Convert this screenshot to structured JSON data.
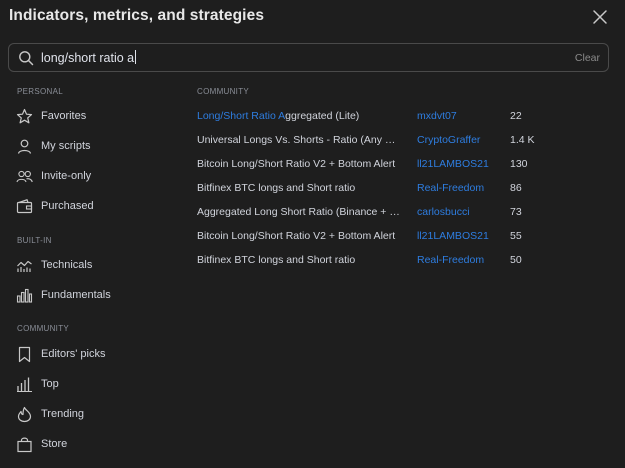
{
  "dialog": {
    "title": "Indicators, metrics, and strategies"
  },
  "search": {
    "value": "long/short ratio a",
    "clear_label": "Clear"
  },
  "sidebar": {
    "personal_heading": "PERSONAL",
    "personal": [
      {
        "label": "Favorites",
        "icon": "star-icon"
      },
      {
        "label": "My scripts",
        "icon": "user-icon"
      },
      {
        "label": "Invite-only",
        "icon": "users-icon"
      },
      {
        "label": "Purchased",
        "icon": "wallet-icon"
      }
    ],
    "builtin_heading": "BUILT-IN",
    "builtin": [
      {
        "label": "Technicals",
        "icon": "technicals-chart-icon"
      },
      {
        "label": "Fundamentals",
        "icon": "bar-chart-icon"
      }
    ],
    "community_heading": "COMMUNITY",
    "community": [
      {
        "label": "Editors' picks",
        "icon": "bookmark-icon"
      },
      {
        "label": "Top",
        "icon": "top-bars-icon"
      },
      {
        "label": "Trending",
        "icon": "trending-icon"
      },
      {
        "label": "Store",
        "icon": "shopping-bag-icon"
      }
    ]
  },
  "results": {
    "heading": "COMMUNITY",
    "highlight_color": "#2e7de0",
    "rows": [
      {
        "name_hl": "Long/Short Ratio A",
        "name_rest": "ggregated (Lite)",
        "author": "mxdvt07",
        "likes": "22"
      },
      {
        "name_hl": "",
        "name_rest": "Universal Longs Vs. Shorts - Ratio (Any Symbol)",
        "author": "CryptoGraffer",
        "likes": "1.4 K"
      },
      {
        "name_hl": "",
        "name_rest": "Bitcoin Long/Short Ratio V2 + Bottom Alert",
        "author": "ll21LAMBOS21",
        "likes": "130"
      },
      {
        "name_hl": "",
        "name_rest": "Bitfinex BTC longs and Short ratio",
        "author": "Real-Freedom",
        "likes": "86"
      },
      {
        "name_hl": "",
        "name_rest": "Aggregated Long Short Ratio (Binance + Bybit)",
        "author": "carlosbucci",
        "likes": "73"
      },
      {
        "name_hl": "",
        "name_rest": "Bitcoin Long/Short Ratio V2 + Bottom Alert",
        "author": "ll21LAMBOS21",
        "likes": "55"
      },
      {
        "name_hl": "",
        "name_rest": "Bitfinex BTC longs and Short ratio",
        "author": "Real-Freedom",
        "likes": "50"
      }
    ]
  }
}
